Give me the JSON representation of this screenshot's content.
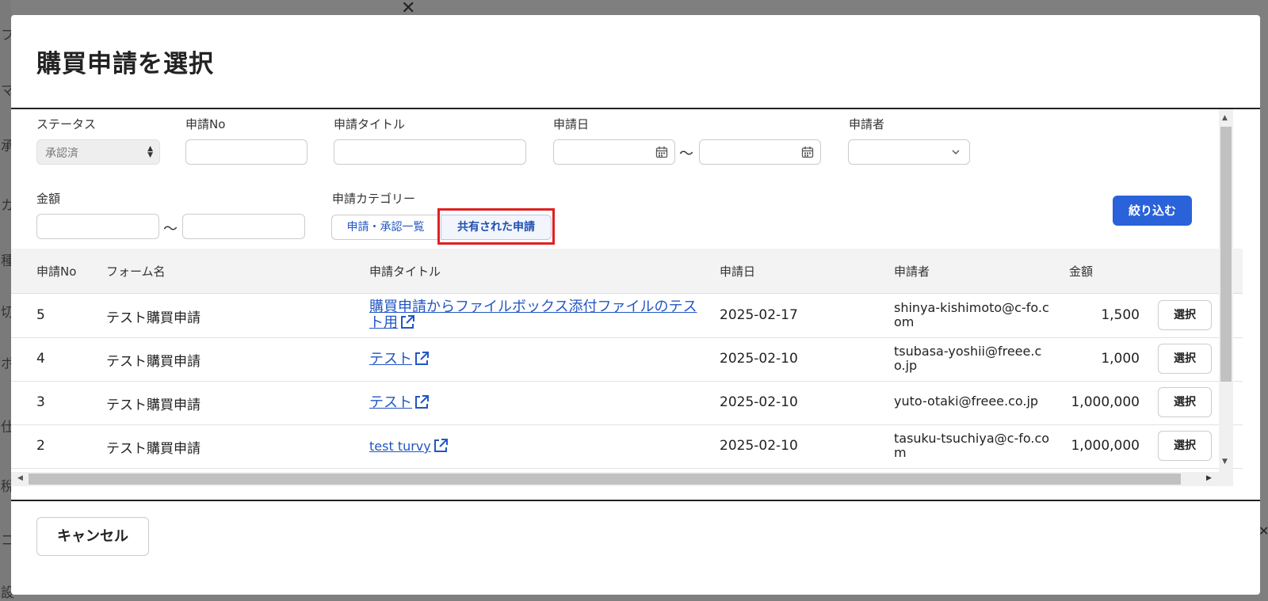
{
  "background": {
    "side_chars": [
      "フ",
      "マ",
      "承",
      "カ",
      "種",
      "切",
      "ボ",
      "仕",
      "稅",
      "コ",
      "設"
    ]
  },
  "modal": {
    "title": "購買申請を選択",
    "cancel_label": "キャンセル"
  },
  "filters": {
    "status_label": "ステータス",
    "status_value": "承認済",
    "no_label": "申請No",
    "title_label": "申請タイトル",
    "date_label": "申請日",
    "applicant_label": "申請者",
    "amount_label": "金額",
    "category_label": "申請カテゴリー",
    "category_options": [
      "申請・承認一覧",
      "共有された申請"
    ],
    "category_selected": "共有された申請",
    "range_separator": "〜",
    "filter_button": "絞り込む"
  },
  "table": {
    "headers": [
      "申請No",
      "フォーム名",
      "申請タイトル",
      "申請日",
      "申請者",
      "金額"
    ],
    "select_label": "選択",
    "rows": [
      {
        "no": "5",
        "form": "テスト購買申請",
        "title": "購買申請からファイルボックス添付ファイルのテスト用",
        "date": "2025-02-17",
        "applicant": "shinya-kishimoto@c-fo.com",
        "amount": "1,500"
      },
      {
        "no": "4",
        "form": "テスト購買申請",
        "title": "テスト",
        "date": "2025-02-10",
        "applicant": "tsubasa-yoshii@freee.co.jp",
        "amount": "1,000"
      },
      {
        "no": "3",
        "form": "テスト購買申請",
        "title": "テスト",
        "date": "2025-02-10",
        "applicant": "yuto-otaki@freee.co.jp",
        "amount": "1,000,000"
      },
      {
        "no": "2",
        "form": "テスト購買申請",
        "title": "test turvy",
        "date": "2025-02-10",
        "applicant": "tasuku-tsuchiya@c-fo.com",
        "amount": "1,000,000"
      }
    ]
  },
  "colors": {
    "accent": "#2962d9",
    "link": "#2256c4",
    "highlight": "#e02020"
  }
}
